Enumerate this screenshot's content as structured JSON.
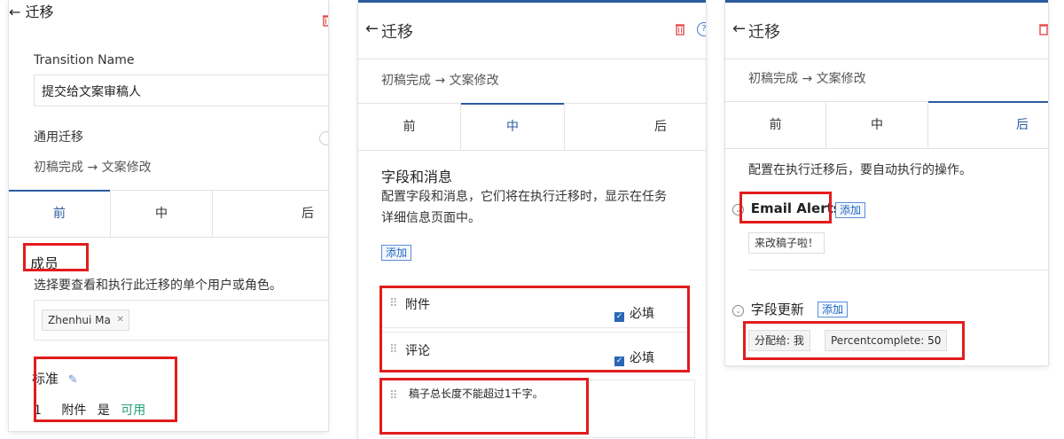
{
  "panel1": {
    "title": "迁移",
    "transition_name_label": "Transition Name",
    "transition_name_value": "提交给文案审稿人",
    "general_transition_label": "通用迁移",
    "route": "初稿完成 → 文案修改",
    "tabs": [
      "前",
      "中",
      "后"
    ],
    "active_tab": 0,
    "members_heading": "成员",
    "members_desc": "选择要查看和执行此迁移的单个用户或角色。",
    "member_chip": "Zhenhui Ma",
    "criteria_heading": "标准",
    "criteria_row": {
      "index": "1",
      "field": "附件",
      "op": "是",
      "value": "可用"
    }
  },
  "panel2": {
    "title": "迁移",
    "route": "初稿完成 → 文案修改",
    "tabs": [
      "前",
      "中",
      "后"
    ],
    "active_tab": 1,
    "section_heading": "字段和消息",
    "section_desc_line1": "配置字段和消息，它们将在执行迁移时，显示在任务",
    "section_desc_line2": "详细信息页面中。",
    "add_label": "添加",
    "fields": [
      {
        "name": "附件",
        "required_label": "必填"
      },
      {
        "name": "评论",
        "required_label": "必填"
      }
    ],
    "message": "稿子总长度不能超过1千字。"
  },
  "panel3": {
    "title": "迁移",
    "route": "初稿完成 → 文案修改",
    "tabs": [
      "前",
      "中",
      "后"
    ],
    "active_tab": 2,
    "desc": "配置在执行迁移后，要自动执行的操作。",
    "email_alerts_label": "Email Alerts",
    "add_label": "添加",
    "email_chip": "来改稿子啦！",
    "field_update_label": "字段更新",
    "field_update_add": "添加",
    "updates": [
      {
        "label": "分配给: 我"
      },
      {
        "label": "Percentcomplete:",
        "value": "50"
      }
    ]
  },
  "colors": {
    "accent": "#2c5b9e",
    "highlight": "#e21c1c",
    "success": "#22a07a",
    "danger": "#e04b4b"
  },
  "icons": [
    "back-arrow-icon",
    "trash-icon",
    "help-icon",
    "edit-pencil-icon",
    "drag-handle-icon",
    "checkbox-checked-icon",
    "remove-x-icon",
    "collapse-chevron-icon"
  ]
}
